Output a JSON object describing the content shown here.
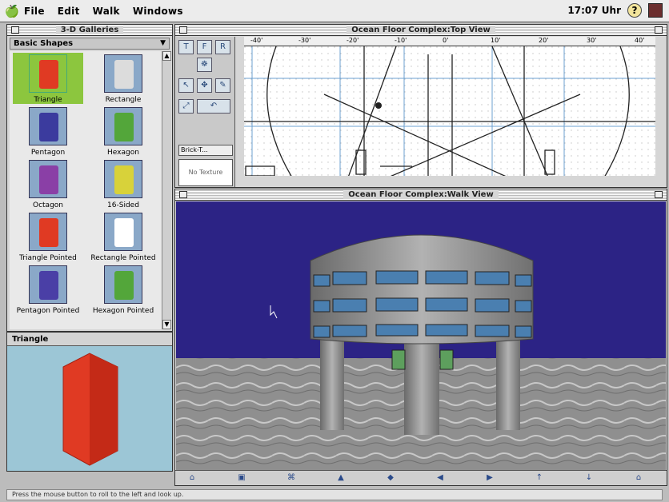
{
  "menubar": {
    "items": [
      "File",
      "Edit",
      "Walk",
      "Windows"
    ],
    "clock": "17:07 Uhr",
    "help_icon": "?"
  },
  "gallery": {
    "title": "3-D Galleries",
    "category": "Basic Shapes",
    "shapes": [
      {
        "label": "Triangle",
        "color": "#e03a23",
        "selected": true
      },
      {
        "label": "Rectangle",
        "color": "#dcdcdc",
        "selected": false
      },
      {
        "label": "Pentagon",
        "color": "#3b3b9e",
        "selected": false
      },
      {
        "label": "Hexagon",
        "color": "#53a63a",
        "selected": false
      },
      {
        "label": "Octagon",
        "color": "#8a3fa6",
        "selected": false
      },
      {
        "label": "16-Sided",
        "color": "#d8d23a",
        "selected": false
      },
      {
        "label": "Triangle Pointed",
        "color": "#e03a23",
        "selected": false
      },
      {
        "label": "Rectangle Pointed",
        "color": "#ffffff",
        "selected": false
      },
      {
        "label": "Pentagon Pointed",
        "color": "#4a3fa6",
        "selected": false
      },
      {
        "label": "Hexagon Pointed",
        "color": "#53a63a",
        "selected": false
      }
    ]
  },
  "preview": {
    "title": "Triangle",
    "color": "#e03a23"
  },
  "topview": {
    "title": "Ocean Floor Complex:Top View",
    "ruler_labels": [
      "-40'",
      "-30'",
      "-20'",
      "-10'",
      "0'",
      "10'",
      "20'",
      "30'",
      "40'"
    ],
    "tools": [
      "T",
      "F",
      "R",
      "☸",
      "↖",
      "✥",
      "✎",
      "⤢",
      "↶"
    ],
    "texture_dropdown": "Brick-T...",
    "texture_placeholder": "No Texture"
  },
  "walkview": {
    "title": "Ocean Floor Complex:Walk View",
    "nav_icons": [
      "⌂",
      "▣",
      "⌘",
      "▲",
      "◆",
      "◀",
      "▶",
      "↑",
      "↓",
      "⌂"
    ]
  },
  "status": {
    "text": "Press the mouse button to roll to the left and look up."
  },
  "colors": {
    "water": "#2c2385",
    "floor": "#8d8d8d",
    "building": "#9a9a9a",
    "windows": "#4a7fb0"
  }
}
